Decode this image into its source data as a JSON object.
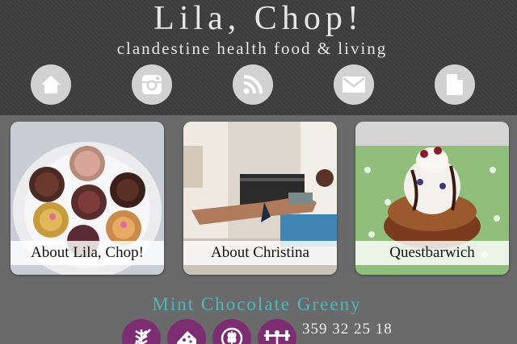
{
  "site": {
    "title": "Lila, Chop!",
    "tagline": "clandestine health food & living"
  },
  "nav": [
    {
      "icon": "home-icon"
    },
    {
      "icon": "instagram-icon"
    },
    {
      "icon": "rss-icon"
    },
    {
      "icon": "mail-icon"
    },
    {
      "icon": "document-icon"
    }
  ],
  "cards": [
    {
      "label": "About Lila, Chop!"
    },
    {
      "label": "About Christina"
    },
    {
      "label": "Questbarwich"
    }
  ],
  "recipe": {
    "title": "Mint Chocolate Greeny",
    "meta": "359 32 25 18",
    "icons": [
      "gluten-free-icon",
      "dairy-free-icon",
      "grain-free-icon",
      "protein-icon"
    ]
  },
  "colors": {
    "header_bg": "#3e3e3e",
    "page_bg": "#6a6a6a",
    "recipe_title": "#4fb6bf",
    "diet_icon_bg": "#7d2e73"
  }
}
